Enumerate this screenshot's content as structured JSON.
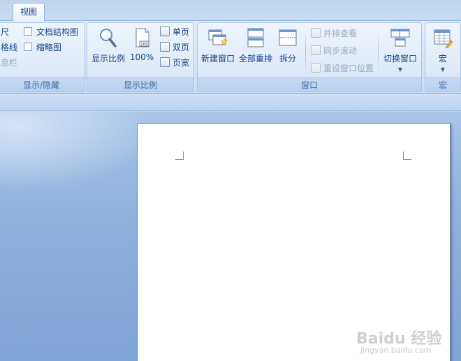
{
  "tabs": {
    "active": "视图"
  },
  "groups": {
    "show_hide": {
      "label": "显示/隐藏",
      "items": [
        {
          "label": "尺",
          "checked": false
        },
        {
          "label": "格线",
          "checked": false
        },
        {
          "label": "息栏",
          "checked": false
        },
        {
          "label": "文档结构图",
          "checked": false
        },
        {
          "label": "缩略图",
          "checked": false
        }
      ]
    },
    "zoom": {
      "label": "显示比例",
      "zoom_button": "显示比例",
      "hundred_button": "100%",
      "hundred_icon_text": "100",
      "single_page": "单页",
      "two_pages": "双页",
      "page_width": "页宽"
    },
    "window": {
      "label": "窗口",
      "new_window": "新建窗口",
      "arrange_all": "全部重排",
      "split": "拆分",
      "side_by_side": "并排查看",
      "sync_scroll": "同步滚动",
      "reset_position": "重设窗口位置",
      "switch_windows": "切换窗口"
    },
    "macros": {
      "label": "宏",
      "macros_button": "宏"
    }
  },
  "watermark": {
    "logo": "Baidu 经验",
    "url": "jingyan.baidu.com"
  },
  "colors": {
    "ribbon_text": "#15428b",
    "group_label": "#3e6aa8",
    "disabled_text": "#9aa9bd",
    "workspace": "#8fb1de",
    "page": "#ffffff"
  }
}
